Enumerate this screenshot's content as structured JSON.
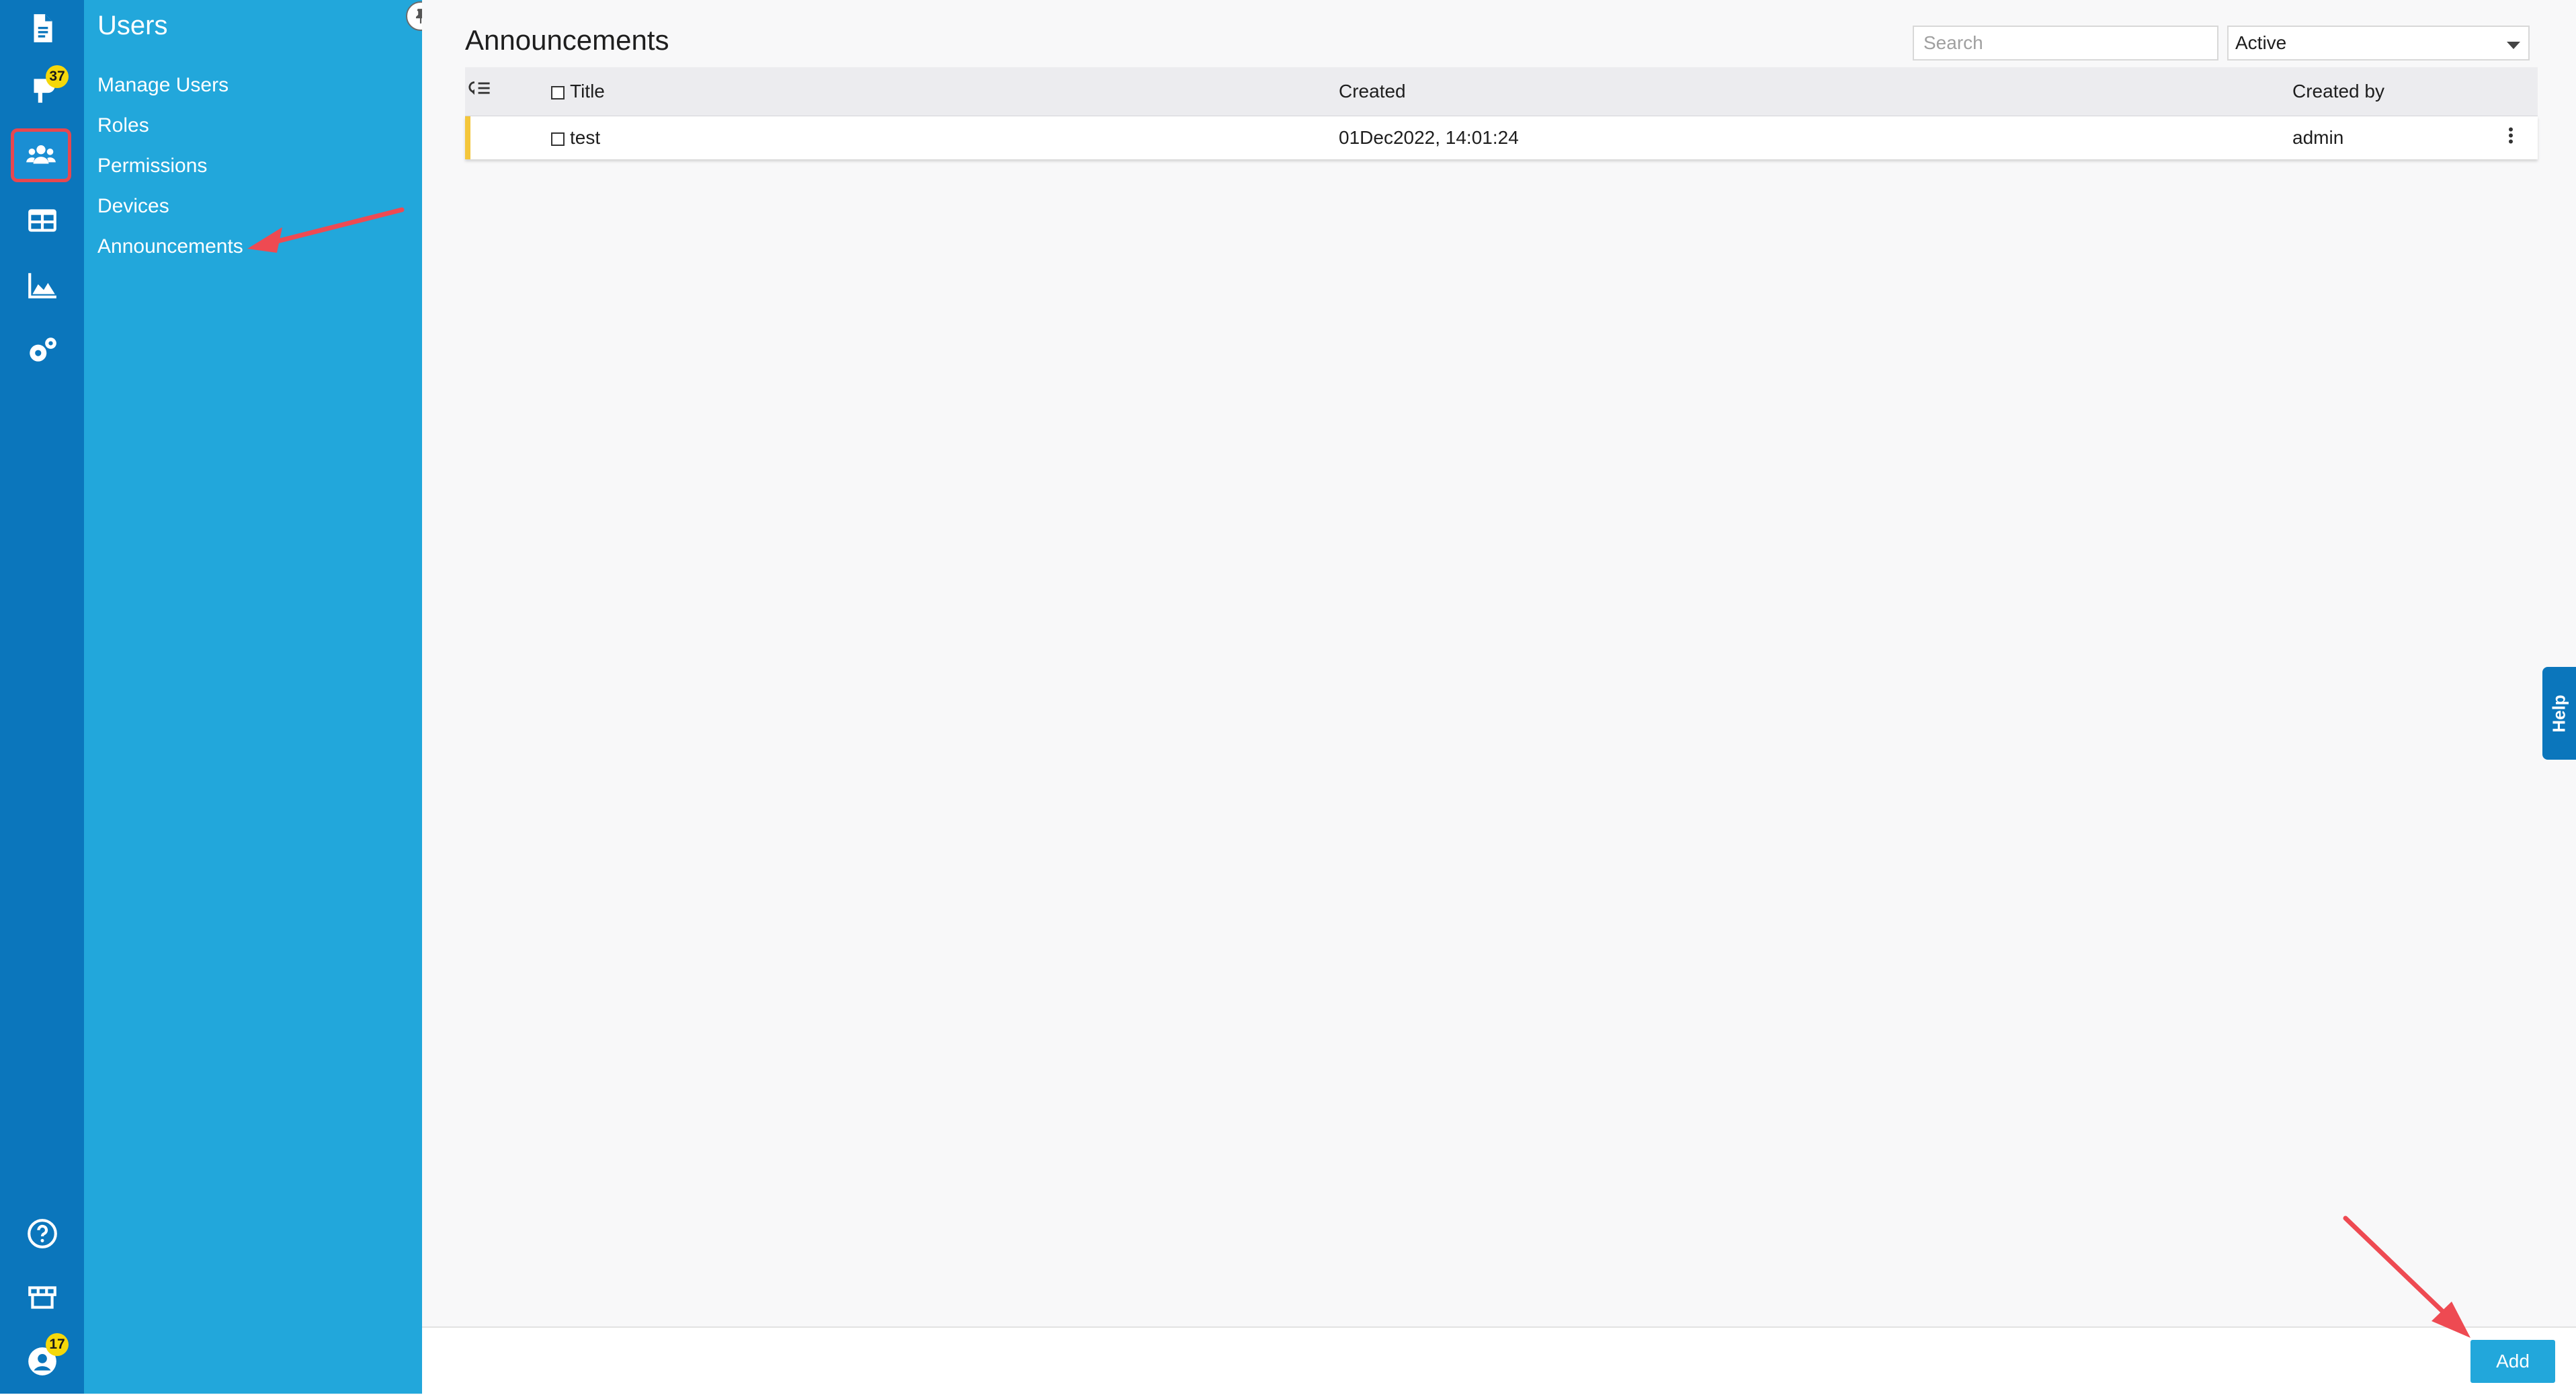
{
  "rail": {
    "notifications_badge": "37",
    "profile_badge": "17"
  },
  "panel": {
    "title": "Users",
    "items": [
      {
        "label": "Manage Users"
      },
      {
        "label": "Roles"
      },
      {
        "label": "Permissions"
      },
      {
        "label": "Devices"
      },
      {
        "label": "Announcements"
      }
    ]
  },
  "main": {
    "title": "Announcements",
    "search_placeholder": "Search",
    "filter_value": "Active",
    "columns": {
      "title": "Title",
      "created": "Created",
      "created_by": "Created by"
    },
    "rows": [
      {
        "title": "test",
        "created": "01Dec2022, 14:01:24",
        "created_by": "admin"
      }
    ]
  },
  "footer": {
    "add_label": "Add"
  },
  "help": {
    "label": "Help"
  },
  "colors": {
    "rail": "#0b76bc",
    "panel": "#22a7db",
    "accent": "#22a7db",
    "row_marker": "#f4c63b",
    "annotation": "#e8474f"
  }
}
